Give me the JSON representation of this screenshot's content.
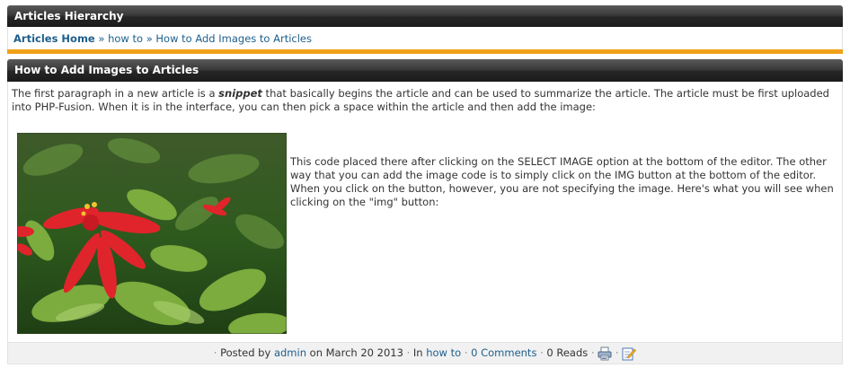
{
  "hierarchy": {
    "title": "Articles Hierarchy"
  },
  "breadcrumb": {
    "home": "Articles Home",
    "separator": "»",
    "category": "how to",
    "current": "How to Add Images to Articles"
  },
  "article": {
    "title": "How to Add Images to Articles",
    "intro_before": "The first paragraph in a new article is a ",
    "intro_emphasis": "snippet",
    "intro_after": " that basically begins the article and can be used to summarize the article. The article must be first uploaded into PHP-Fusion. When it is in the interface, you can then pick a space within the article and then add the image:",
    "side_text": "This code placed there after clicking on the SELECT IMAGE option at the bottom of the editor. The other way that you can add the image code is to simply click on the IMG button at the bottom of the editor. When you click on the button, however, you are not specifying the image. Here's what you will see when clicking on the \"img\" button:"
  },
  "footer": {
    "bullet": "·",
    "posted_by": "Posted by",
    "author": "admin",
    "date_text": "on March 20 2013",
    "in_label": "In",
    "category": "how to",
    "comments": "0 Comments",
    "reads": "0 Reads",
    "print_icon": "printer-icon",
    "edit_icon": "edit-icon"
  },
  "colors": {
    "accent": "#f0a11a",
    "link": "#1e5f8c",
    "bar": "#2b2b2b"
  }
}
